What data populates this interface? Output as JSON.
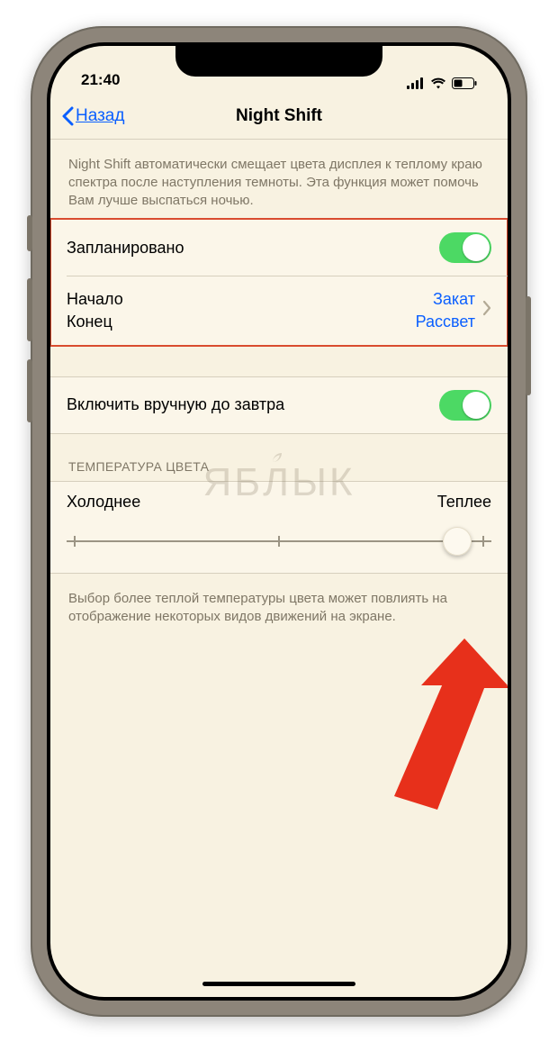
{
  "statusbar": {
    "time": "21:40"
  },
  "nav": {
    "back": "Назад",
    "title": "Night Shift"
  },
  "intro": "Night Shift автоматически смещает цвета дисплея к теплому краю спектра после наступления темноты. Эта функция может помочь Вам лучше выспаться ночью.",
  "scheduled": {
    "label": "Запланировано",
    "on": true,
    "from_label": "Начало",
    "to_label": "Конец",
    "from_value": "Закат",
    "to_value": "Рассвет"
  },
  "manual": {
    "label": "Включить вручную до завтра",
    "on": true
  },
  "temp_header": "ТЕМПЕРАТУРА ЦВЕТА",
  "slider": {
    "cold_label": "Холоднее",
    "warm_label": "Теплее",
    "value_pct": 92
  },
  "footer": "Выбор более теплой температуры цвета может повлиять на отображение некоторых видов движений на экране.",
  "watermark": "ЯБЛЫК"
}
